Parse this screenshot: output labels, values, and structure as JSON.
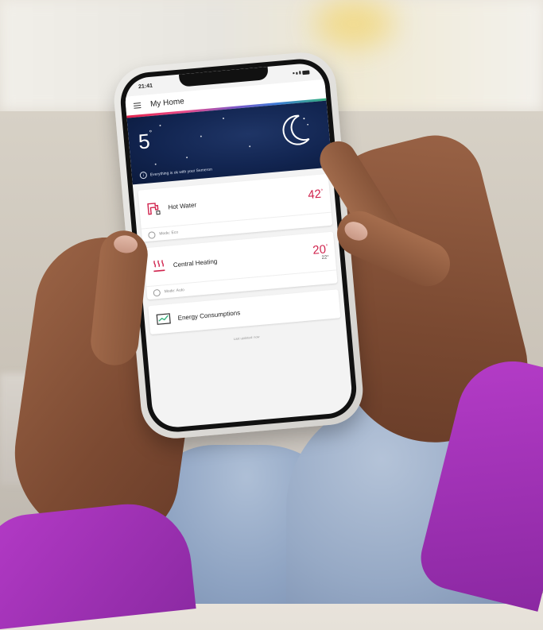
{
  "statusbar": {
    "time": "21:41"
  },
  "app": {
    "title": "My Home"
  },
  "weather": {
    "outside_temp": "5",
    "degree_symbol": "°",
    "status_text": "Everything is ok with your Semeron"
  },
  "devices": [
    {
      "label": "Hot Water",
      "temp": "42",
      "degree": "°",
      "mode": "Mode: Eco"
    },
    {
      "label": "Central Heating",
      "temp": "20",
      "degree": "°",
      "sub_temp": "22°",
      "mode": "Mode: Auto"
    }
  ],
  "energy": {
    "label": "Energy Consumptions",
    "updated": "Last updated: now"
  },
  "colors": {
    "accent": "#d0234d",
    "hero_bg": "#122551",
    "sleeve": "#a233b8",
    "jeans": "#96a9c5"
  },
  "icons": {
    "hot_water": "tap-icon",
    "central_heating": "radiator-icon",
    "energy": "energy-monitor-icon",
    "weather": "moon-icon"
  }
}
